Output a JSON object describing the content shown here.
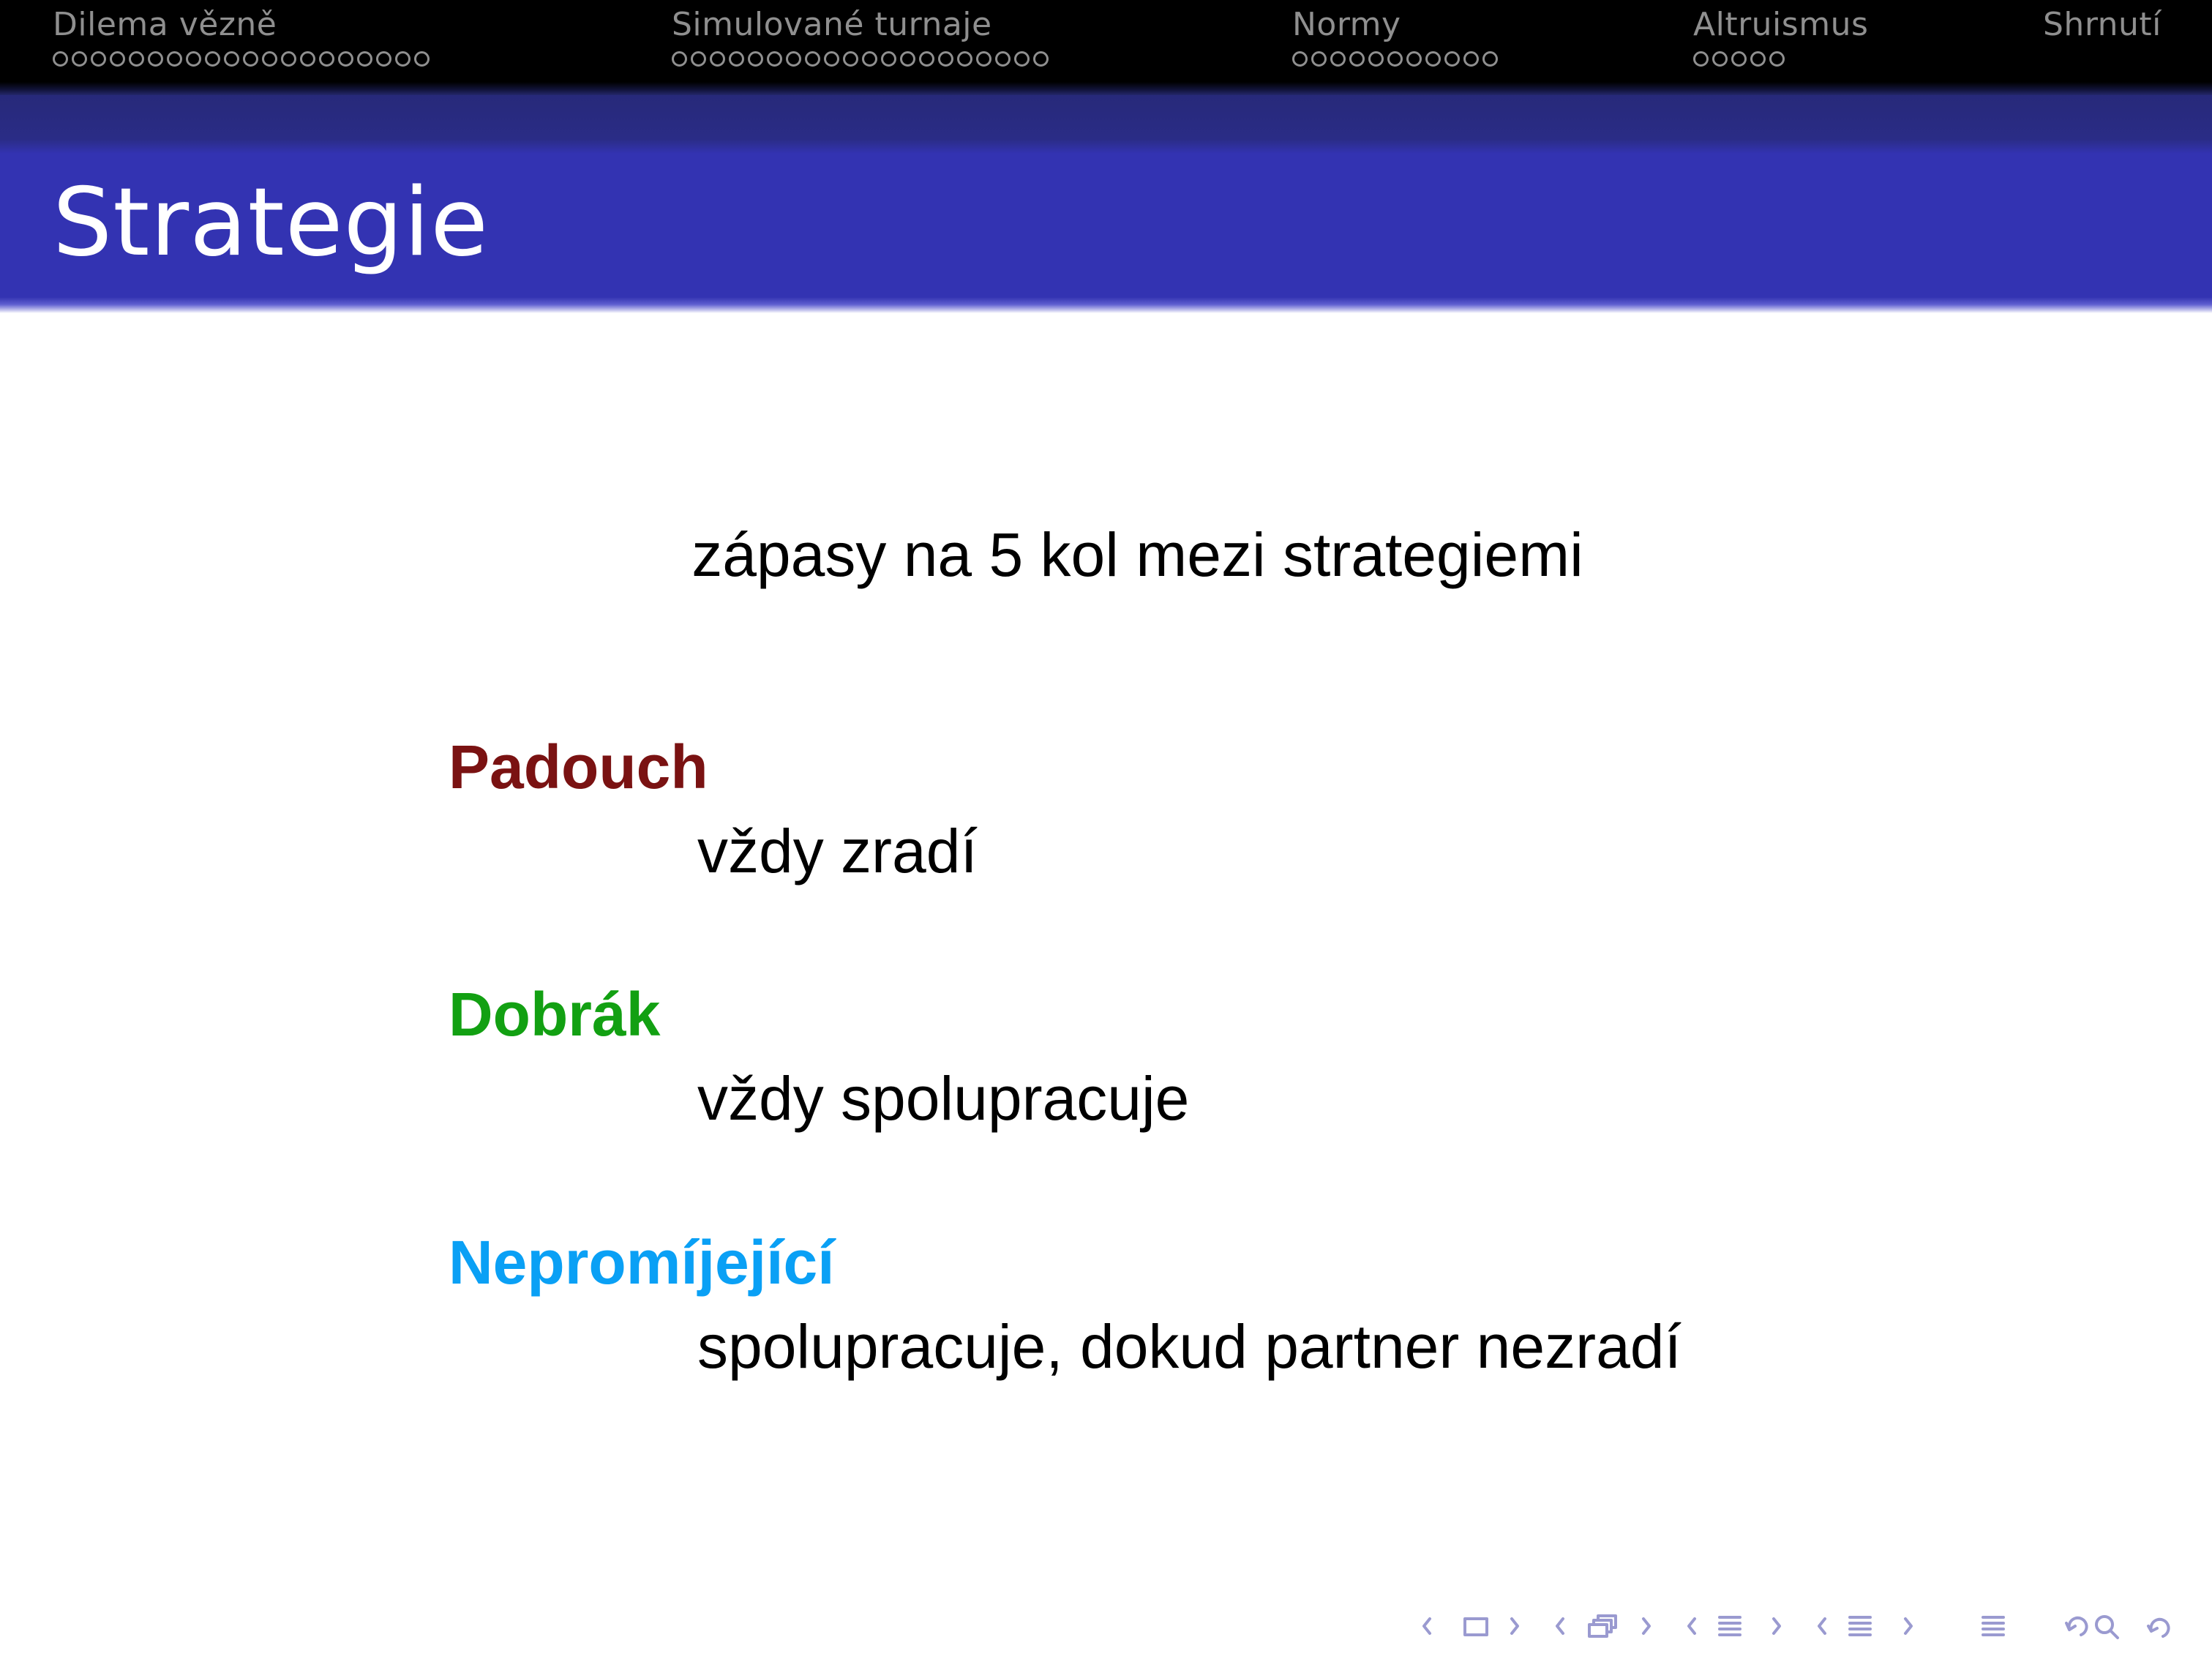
{
  "navbar": {
    "sections": [
      {
        "label": "Dilema vězně",
        "dots": 20,
        "active": false
      },
      {
        "label": "Simulované turnaje",
        "dots": 20,
        "active": true
      },
      {
        "label": "Normy",
        "dots": 11,
        "active": false
      },
      {
        "label": "Altruismus",
        "dots": 5,
        "active": false
      },
      {
        "label": "Shrnutí",
        "dots": 0,
        "active": false
      }
    ]
  },
  "frame": {
    "title": "Strategie"
  },
  "content": {
    "intro": "zápasy na 5 kol mezi strategiemi",
    "strategies": [
      {
        "name": "Padouch",
        "description": "vždy zradí",
        "color": "#7a1212"
      },
      {
        "name": "Dobrák",
        "description": "vždy spolupracuje",
        "color": "#12a012"
      },
      {
        "name": "Nepromíjející",
        "description": "spolupracuje, dokud partner nezradí",
        "color": "#0aa0f5"
      }
    ]
  },
  "nav_symbols": {
    "color": "#9a9ad0",
    "icons": [
      "nav-frame-icon",
      "nav-subsection-icon",
      "nav-section-icon",
      "nav-document-icon",
      "nav-outline-icon",
      "search-icon",
      "undo-icon"
    ]
  }
}
